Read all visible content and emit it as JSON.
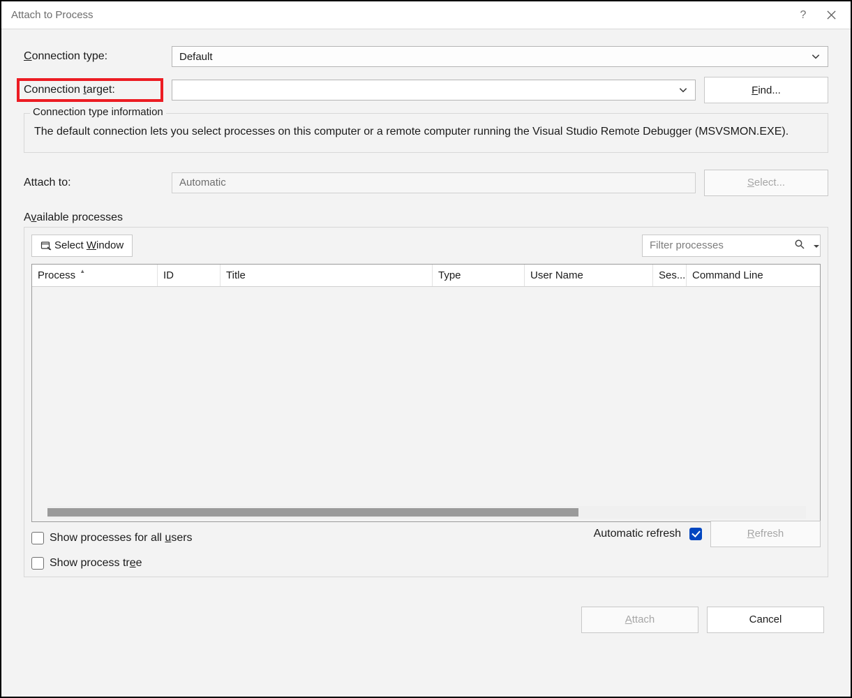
{
  "window": {
    "title": "Attach to Process",
    "help_tooltip": "?",
    "close_tooltip": "Close"
  },
  "labels": {
    "connection_type": "Connection type:",
    "connection_target": "Connection target:",
    "attach_to": "Attach to:",
    "available_processes": "Available processes",
    "connection_type_info": "Connection type information"
  },
  "fields": {
    "connection_type_value": "Default",
    "connection_target_value": "",
    "attach_to_value": "Automatic"
  },
  "buttons": {
    "find": "Find...",
    "select": "Select...",
    "select_window": "Select Window",
    "refresh": "Refresh",
    "attach": "Attach",
    "cancel": "Cancel"
  },
  "info_text": "The default connection lets you select processes on this computer or a remote computer running the Visual Studio Remote Debugger (MSVSMON.EXE).",
  "filter": {
    "placeholder": "Filter processes"
  },
  "table": {
    "columns": {
      "process": "Process",
      "id": "ID",
      "title": "Title",
      "type": "Type",
      "user_name": "User Name",
      "session": "Ses...",
      "command_line": "Command Line"
    },
    "rows": []
  },
  "checkboxes": {
    "show_all_users": "Show processes for all users",
    "show_process_tree": "Show process tree",
    "automatic_refresh": "Automatic refresh"
  },
  "state": {
    "show_all_users": false,
    "show_process_tree": false,
    "automatic_refresh": true
  },
  "underline_hints": {
    "connection_type_char": "C",
    "connection_target_char": "t",
    "available_char": "v",
    "find_char": "F",
    "select_char": "S",
    "select_window_char": "W",
    "users_char": "u",
    "tree_char": "e",
    "refresh_char": "R",
    "attach_char": "A"
  }
}
